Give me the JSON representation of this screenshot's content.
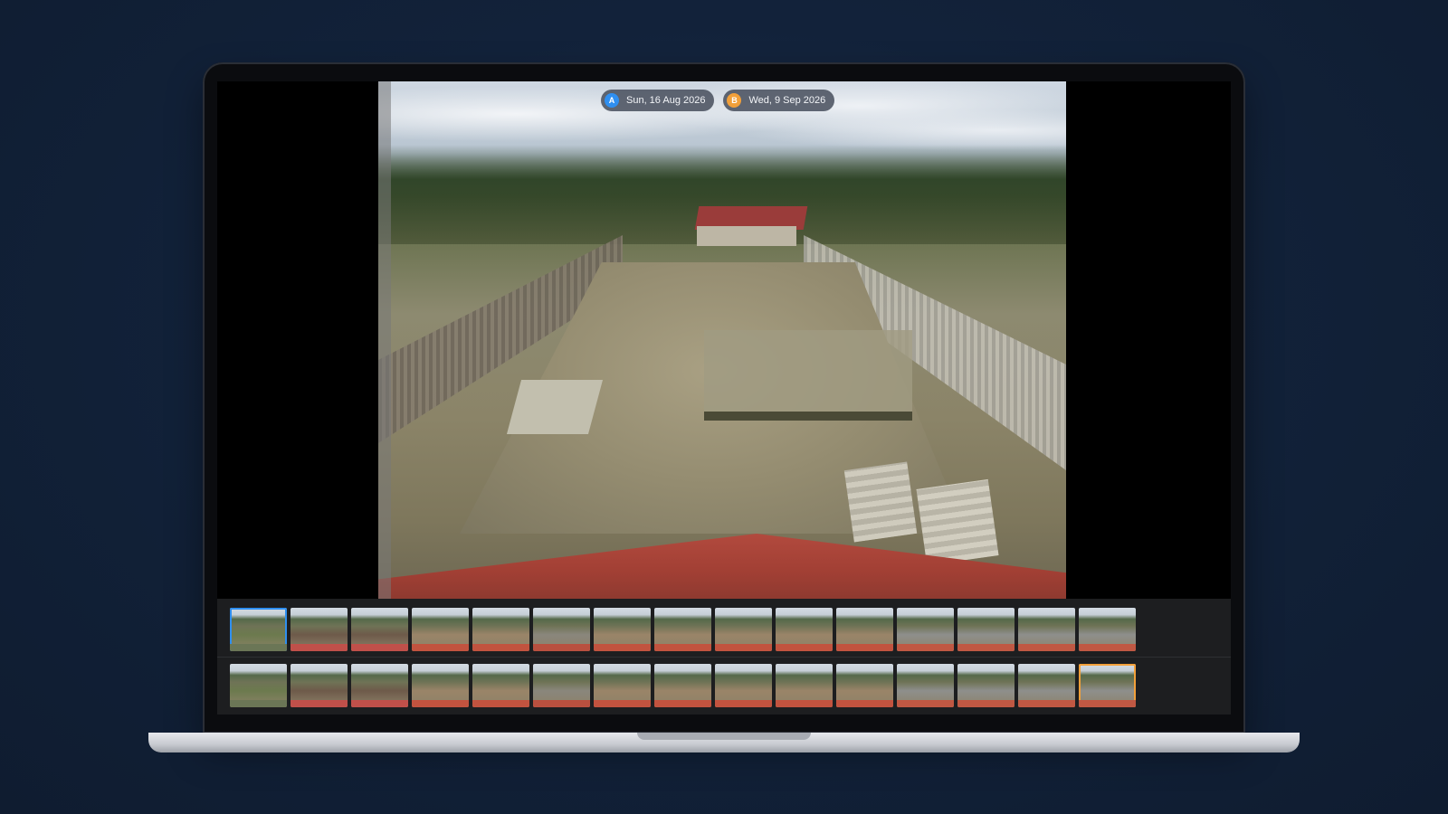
{
  "viewer": {
    "badge_a": {
      "letter": "A",
      "date": "Sun, 16 Aug 2026",
      "color": "#2f8ff0"
    },
    "badge_b": {
      "letter": "B",
      "date": "Wed, 9 Sep 2026",
      "color": "#f2a03a"
    }
  },
  "filmstrip": {
    "row_a": {
      "selected_index": 0,
      "selected_color": "#2f8ff0",
      "thumbnails": [
        {
          "tone": "grass"
        },
        {
          "tone": "soil-dark"
        },
        {
          "tone": "soil-dark"
        },
        {
          "tone": "soil-light"
        },
        {
          "tone": "soil-light"
        },
        {
          "tone": "grey"
        },
        {
          "tone": "soil-light"
        },
        {
          "tone": "soil-light"
        },
        {
          "tone": "soil-light"
        },
        {
          "tone": "soil-light"
        },
        {
          "tone": "soil-light"
        },
        {
          "tone": "slab"
        },
        {
          "tone": "slab"
        },
        {
          "tone": "slab"
        },
        {
          "tone": "slab"
        }
      ]
    },
    "row_b": {
      "selected_index": 14,
      "selected_color": "#f2a03a",
      "thumbnails": [
        {
          "tone": "grass"
        },
        {
          "tone": "soil-dark"
        },
        {
          "tone": "soil-dark"
        },
        {
          "tone": "soil-light"
        },
        {
          "tone": "soil-light"
        },
        {
          "tone": "grey"
        },
        {
          "tone": "soil-light"
        },
        {
          "tone": "soil-light"
        },
        {
          "tone": "soil-light"
        },
        {
          "tone": "soil-light"
        },
        {
          "tone": "soil-light"
        },
        {
          "tone": "slab"
        },
        {
          "tone": "slab"
        },
        {
          "tone": "slab"
        },
        {
          "tone": "slab"
        }
      ]
    }
  }
}
